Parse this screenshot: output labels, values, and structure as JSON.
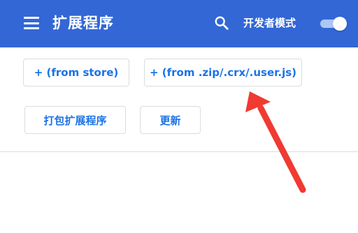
{
  "header": {
    "title": "扩展程序",
    "developer_mode_label": "开发者模式",
    "developer_mode_enabled": true,
    "background_color": "#3367d6",
    "menu_icon": "hamburger-menu-icon",
    "search_icon": "search-icon"
  },
  "toolbar": {
    "load_from_store_label": "+ (from store)",
    "load_from_file_label": "+ (from .zip/.crx/.user.js)",
    "pack_extension_label": "打包扩展程序",
    "update_label": "更新"
  },
  "annotation": {
    "arrow_color": "#f03a32"
  }
}
